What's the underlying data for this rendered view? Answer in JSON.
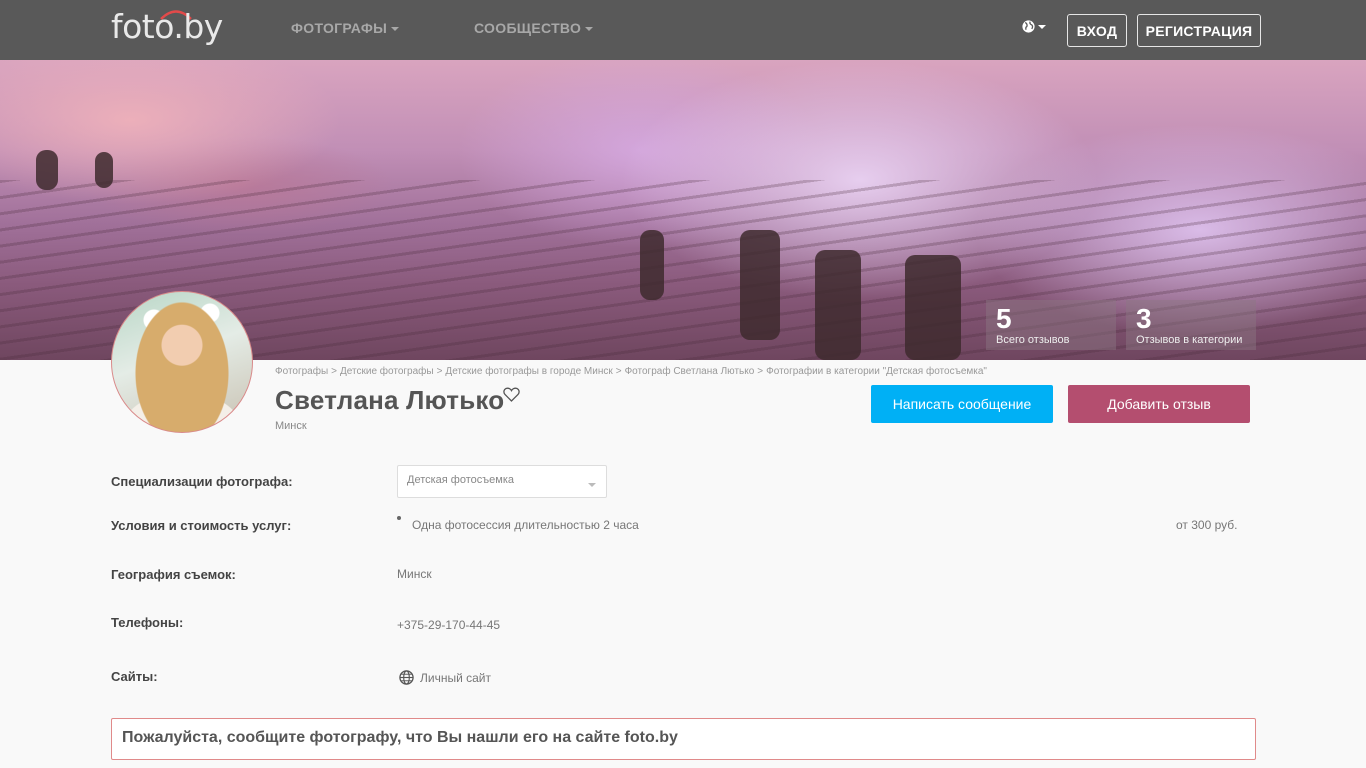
{
  "header": {
    "logo_text": "foto.by",
    "nav": [
      {
        "label": "ФОТОГРАФЫ"
      },
      {
        "label": "СООБЩЕСТВО"
      }
    ],
    "login_label": "ВХОД",
    "register_label": "РЕГИСТРАЦИЯ",
    "language_icon": "globe-icon"
  },
  "cover": {
    "stats": [
      {
        "value": "5",
        "label": "Всего отзывов"
      },
      {
        "value": "3",
        "label": "Отзывов в категории"
      }
    ]
  },
  "profile": {
    "breadcrumb": [
      "Фотографы",
      "Детские фотографы",
      "Детские фотографы в городе Минск",
      "Фотограф Светлана Лютько",
      "Фотографии в категории \"Детская фотосъемка\""
    ],
    "name": "Светлана Лютько",
    "city": "Минск",
    "favorite_icon": "heart-icon",
    "write_message_label": "Написать сообщение",
    "add_review_label": "Добавить отзыв"
  },
  "details": {
    "specialization_label": "Специализации фотографа:",
    "specialization_value": "Детская фотосъемка",
    "services_label": "Условия и стоимость услуг:",
    "services": [
      {
        "name": "Одна фотосессия длительностью 2 часа",
        "price": "от 300 руб."
      }
    ],
    "geography_label": "География съемок:",
    "geography_value": "Минск",
    "phones_label": "Телефоны:",
    "phone_value": "+375-29-170-44-45",
    "sites_label": "Сайты:",
    "site_value": "Личный сайт"
  },
  "notice": "Пожалуйста, сообщите фотографу, что Вы нашли его на сайте foto.by",
  "colors": {
    "topbar": "#595959",
    "message_button": "#00b0f5",
    "review_button": "#b44e6f",
    "notice_border": "#e08a8a"
  }
}
